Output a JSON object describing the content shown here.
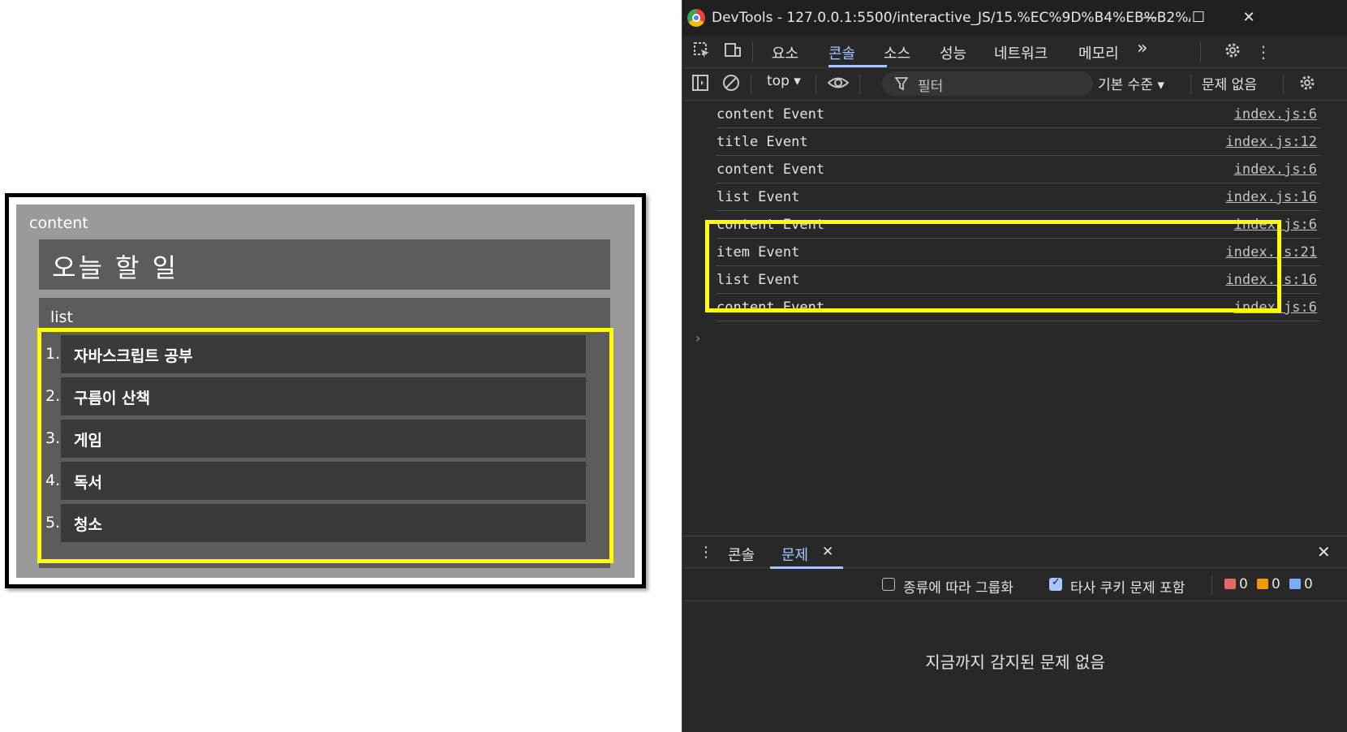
{
  "preview": {
    "content_label": "content",
    "title": "오늘 할 일",
    "list_label": "list",
    "items": [
      {
        "num": "1.",
        "text": "자바스크립트 공부"
      },
      {
        "num": "2.",
        "text": "구름이 산책"
      },
      {
        "num": "3.",
        "text": "게임"
      },
      {
        "num": "4.",
        "text": "독서"
      },
      {
        "num": "5.",
        "text": "청소"
      }
    ]
  },
  "devtools": {
    "window_title": "DevTools - 127.0.0.1:5500/interactive_JS/15.%EC%9D%B4%EB%B2%A4%ED%...",
    "window_controls": {
      "minimize": "—",
      "maximize": "☐",
      "close": "✕"
    },
    "tabs": [
      "요소",
      "콘솔",
      "소스",
      "성능",
      "네트워크",
      "메모리"
    ],
    "tabs_more": "»",
    "toolbar": {
      "context": "top ▾",
      "filter_placeholder": "필터",
      "levels": "기본 수준 ▾",
      "issues": "문제 없음"
    },
    "logs": [
      {
        "msg": "content Event",
        "src": "index.js:6"
      },
      {
        "msg": "title Event",
        "src": "index.js:12"
      },
      {
        "msg": "content Event",
        "src": "index.js:6"
      },
      {
        "msg": "list Event",
        "src": "index.js:16"
      },
      {
        "msg": "content Event",
        "src": "index.js:6"
      },
      {
        "msg": "item Event",
        "src": "index.js:21"
      },
      {
        "msg": "list Event",
        "src": "index.js:16"
      },
      {
        "msg": "content Event",
        "src": "index.js:6"
      }
    ],
    "prompt": "›",
    "drawer": {
      "menu": "⋮",
      "tabs": [
        "콘솔",
        "문제"
      ],
      "tab_close": "✕",
      "close": "✕"
    },
    "issues": {
      "group_by_kind": "종류에 따라 그룹화",
      "include_third_party": "타사 쿠키 문제 포함",
      "error_count": "0",
      "warning_count": "0",
      "info_count": "0",
      "empty_message": "지금까지 감지된 문제 없음"
    },
    "colors": {
      "accent": "#a8c7fa",
      "highlight": "#ffff00",
      "error": "#e46962",
      "warning": "#f29900",
      "info": "#7cacf8"
    }
  }
}
